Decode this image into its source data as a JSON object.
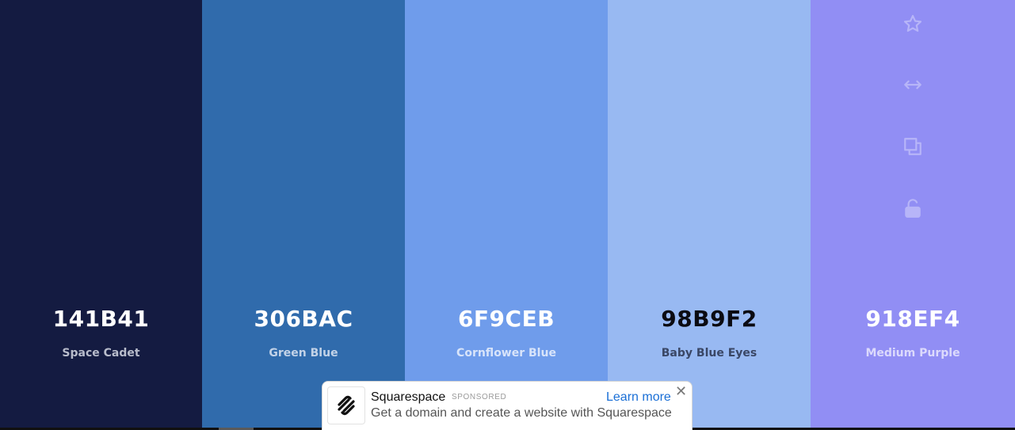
{
  "colors": [
    {
      "hex": "141B41",
      "name": "Space Cadet",
      "bg": "#141B41",
      "hex_text_color": "#ffffff",
      "name_text_color": "#b8bccb"
    },
    {
      "hex": "306BAC",
      "name": "Green Blue",
      "bg": "#306BAC",
      "hex_text_color": "#ffffff",
      "name_text_color": "#c3d3e8"
    },
    {
      "hex": "6F9CEB",
      "name": "Cornflower Blue",
      "bg": "#6F9CEB",
      "hex_text_color": "#ffffff",
      "name_text_color": "#d8e4fa"
    },
    {
      "hex": "98B9F2",
      "name": "Baby Blue Eyes",
      "bg": "#98B9F2",
      "hex_text_color": "#0b0b12",
      "name_text_color": "#3a4766"
    },
    {
      "hex": "918EF4",
      "name": "Medium Purple",
      "bg": "#918EF4",
      "hex_text_color": "#ffffff",
      "name_text_color": "#dcdafc"
    }
  ],
  "toolbar_icons": [
    "star-icon",
    "width-arrows-icon",
    "copy-icon",
    "unlock-icon"
  ],
  "ad": {
    "title": "Squarespace",
    "sponsored": "SPONSORED",
    "cta": "Learn more",
    "close": "✕",
    "description": "Get a domain and create a website with Squarespace"
  }
}
